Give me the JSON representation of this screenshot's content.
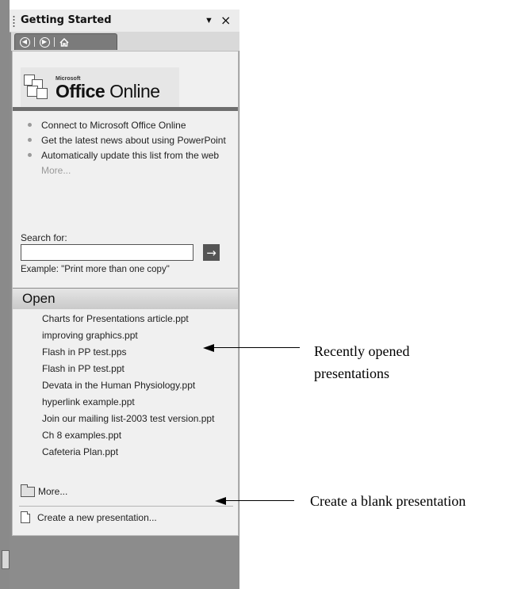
{
  "pane": {
    "title": "Getting Started",
    "dropdown_glyph": "▼",
    "close_glyph": "×"
  },
  "nav": {
    "back_icon": "back-arrow-icon",
    "forward_icon": "forward-arrow-icon",
    "home_icon": "home-icon"
  },
  "logo": {
    "small_text": "Microsoft",
    "brand_bold": "Office",
    "brand_rest": " Online"
  },
  "online_links": [
    "Connect to Microsoft Office Online",
    "Get the latest news about using PowerPoint",
    "Automatically update this list from the web"
  ],
  "online_more": "More...",
  "search": {
    "label": "Search for:",
    "value": "",
    "go_glyph": "→",
    "example": "Example:  \"Print more than one copy\""
  },
  "open_section": {
    "title": "Open",
    "files": [
      "Charts for Presentations article.ppt",
      "improving graphics.ppt",
      "Flash in PP test.pps",
      "Flash in PP test.ppt",
      "Devata in the Human Physiology.ppt",
      "hyperlink example.ppt",
      "Join our mailing list-2003 test version.ppt",
      "Ch 8 examples.ppt",
      "Cafeteria Plan.ppt"
    ],
    "more_label": "More...",
    "create_label": "Create a new presentation..."
  },
  "annotations": {
    "recent_line1": "Recently opened",
    "recent_line2": "presentations",
    "blank": "Create a blank presentation"
  }
}
